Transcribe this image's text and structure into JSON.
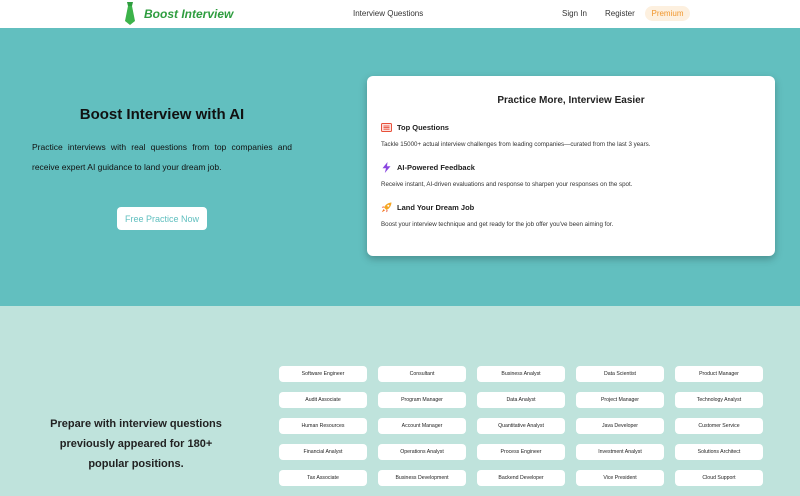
{
  "header": {
    "brand": "Boost Interview",
    "nav_interview_questions": "Interview Questions",
    "nav_sign_in": "Sign In",
    "nav_register": "Register",
    "nav_premium": "Premium"
  },
  "hero": {
    "title": "Boost Interview with AI",
    "description": "Practice interviews with real questions from top companies and receive expert AI guidance to land your dream job.",
    "cta": "Free Practice Now"
  },
  "card": {
    "title": "Practice More, Interview Easier",
    "features": [
      {
        "icon": "list-icon",
        "name": "Top Questions",
        "desc": "Tackle 15000+ actual interview challenges from leading companies—curated from the last 3 years."
      },
      {
        "icon": "lightning-icon",
        "name": "AI-Powered Feedback",
        "desc": "Receive instant, AI-driven evaluations and response to sharpen your responses on the spot."
      },
      {
        "icon": "rocket-icon",
        "name": "Land Your Dream Job",
        "desc": "Boost your interview technique and get ready for the job offer you've been aiming for."
      }
    ]
  },
  "positions_section": {
    "title": "Prepare with interview questions previously appeared for 180+ popular positions.",
    "positions": [
      "Software Engineer",
      "Consultant",
      "Business Analyst",
      "Data Scientist",
      "Product Manager",
      "Audit Associate",
      "Program Manager",
      "Data Analyst",
      "Project Manager",
      "Technology Analyst",
      "Human Resources",
      "Account Manager",
      "Quantitative Analyst",
      "Java Developer",
      "Customer Service",
      "Financial Analyst",
      "Operations Analyst",
      "Process Engineer",
      "Investment Analyst",
      "Solutions Architect",
      "Tax Associate",
      "Business Development",
      "Backend Developer",
      "Vice President",
      "Cloud Support"
    ]
  },
  "colors": {
    "brand_green": "#2e9d3f",
    "hero_bg": "#62bfbf",
    "section_bg": "#bfe3dc",
    "premium_text": "#f0962c"
  }
}
